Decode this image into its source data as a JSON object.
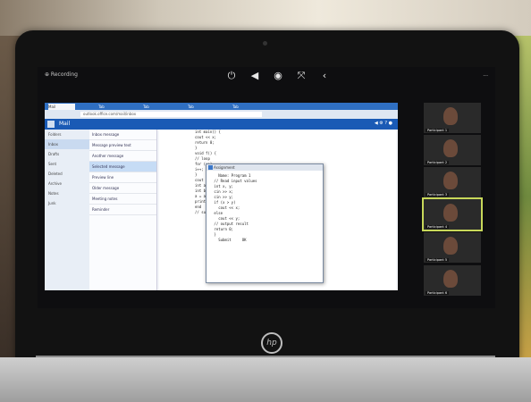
{
  "photo": {
    "hp_logo": "hp"
  },
  "zoom": {
    "topbar_left": "⊕ Recording",
    "topbar_right": "...",
    "controls": [
      {
        "name": "mute",
        "glyph": "⏻"
      },
      {
        "name": "back",
        "glyph": "◀"
      },
      {
        "name": "forward",
        "glyph": "◉"
      },
      {
        "name": "fullscreen",
        "glyph": "⤧"
      },
      {
        "name": "more",
        "glyph": "‹"
      }
    ]
  },
  "browser": {
    "tabs": [
      "Mail",
      "Tab",
      "Tab",
      "Tab",
      "Tab"
    ],
    "url": "outlook.office.com/mail/inbox"
  },
  "mail": {
    "title": "Mail",
    "icons": "◀ ⚙ ? ●",
    "folders": [
      "Folders",
      "Inbox",
      "Drafts",
      "Sent",
      "Deleted",
      "Archive",
      "Notes",
      "Junk"
    ],
    "messages": [
      "Inbox message",
      "Message preview text",
      "Another message",
      "Selected message",
      "Preview line",
      "Older message",
      "Meeting notes",
      "Reminder"
    ],
    "reading_lines": [
      "int main() {",
      "  cout << x;",
      "  return 0;",
      "}",
      "",
      "void f() {",
      "  // loop",
      "  for (;;)",
      "  i++;",
      "}",
      "",
      "cout << \"done\";",
      "int a = 1;",
      "int b = 2;",
      "a = a + b;",
      "print(a);",
      "end",
      "// submit"
    ]
  },
  "code_popup": {
    "title": "Assignment",
    "lines": [
      "   Name: Program 1",
      " // Read input values",
      " int x, y;",
      " cin >> x;",
      " cin >> y;",
      " if (x > y)",
      "   cout << x;",
      " else",
      "   cout << y;",
      " // output result",
      " return 0;",
      " }",
      "",
      "   Submit     OK"
    ]
  },
  "participants": [
    {
      "name": "Participant 1"
    },
    {
      "name": "Participant 2"
    },
    {
      "name": "Participant 3"
    },
    {
      "name": "Participant 4",
      "active": true
    },
    {
      "name": "Participant 5"
    },
    {
      "name": "Participant 6"
    }
  ]
}
